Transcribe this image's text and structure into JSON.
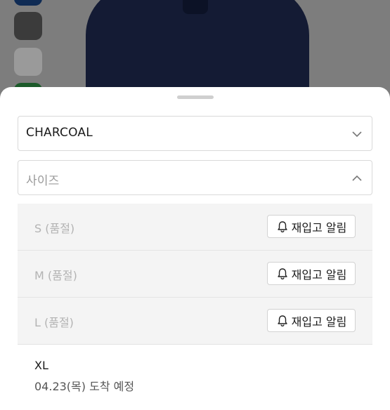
{
  "color_select": {
    "value": "CHARCOAL"
  },
  "size_select": {
    "placeholder": "사이즈"
  },
  "size_options": [
    {
      "label": "S (품절)",
      "button": "재입고 알림"
    },
    {
      "label": "M (품절)",
      "button": "재입고 알림"
    },
    {
      "label": "L (품절)",
      "button": "재입고 알림"
    }
  ],
  "available_option": {
    "label": "XL",
    "arrival": "04.23(목) 도착 예정"
  },
  "icons": {
    "color_select": "chevron-down-icon",
    "size_select": "chevron-up-icon",
    "restock": "bell-icon"
  }
}
